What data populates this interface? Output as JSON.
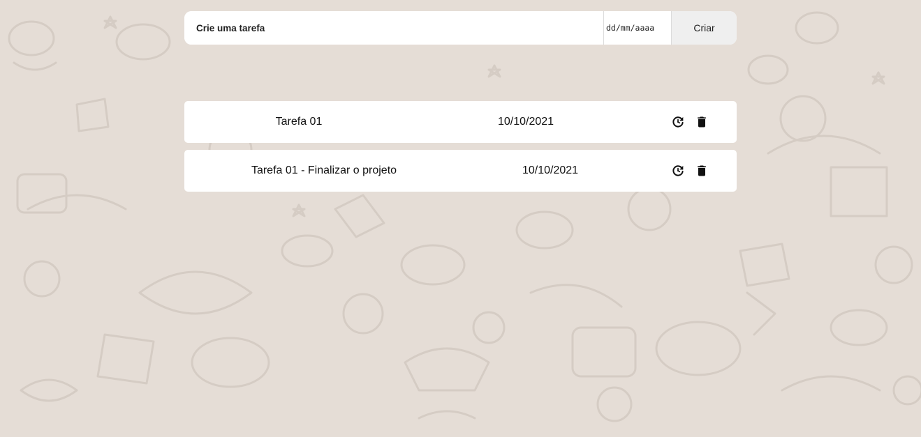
{
  "form": {
    "task_placeholder": "Crie uma tarefa",
    "date_placeholder": "dd/mm/aaaa",
    "create_label": "Criar"
  },
  "tasks": [
    {
      "name": "Tarefa 01",
      "date": "10/10/2021"
    },
    {
      "name": "Tarefa 01 - Finalizar o projeto",
      "date": "10/10/2021"
    }
  ],
  "icons": {
    "update": "refresh-icon",
    "delete": "trash-icon"
  },
  "colors": {
    "background": "#e5ddd6",
    "pattern": "#d3cac2",
    "card": "#ffffff",
    "button": "#efefef"
  }
}
